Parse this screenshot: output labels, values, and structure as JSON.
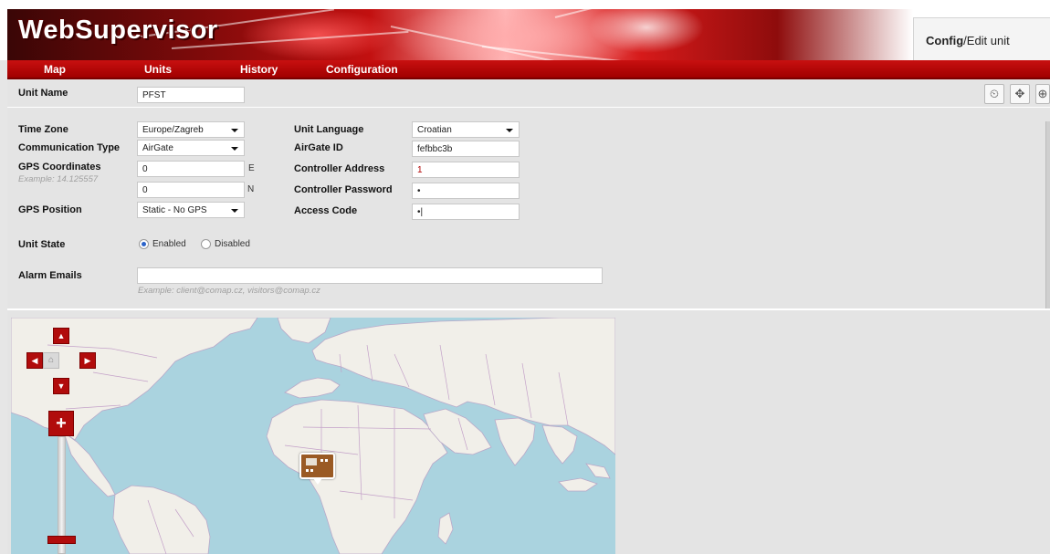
{
  "app": {
    "logo_text": "WebSupervisor",
    "page_tab_strong": "Config",
    "page_tab_rest": "/Edit unit"
  },
  "menu": {
    "items": [
      "Map",
      "Units",
      "History",
      "Configuration"
    ]
  },
  "toolbar": {
    "icons": [
      "settings-clock-icon",
      "move-icon",
      "zoom-icon"
    ]
  },
  "unit": {
    "name_label": "Unit Name",
    "name_value": "PFST"
  },
  "form": {
    "time_zone": {
      "label": "Time Zone",
      "value": "Europe/Zagreb"
    },
    "communication_type": {
      "label": "Communication Type",
      "value": "AirGate"
    },
    "gps_coordinates": {
      "label": "GPS Coordinates",
      "example": "Example: 14.125557",
      "lon_value": "0",
      "lon_suffix": "E",
      "lat_value": "0",
      "lat_suffix": "N"
    },
    "gps_position": {
      "label": "GPS Position",
      "value": "Static - No GPS"
    },
    "unit_language": {
      "label": "Unit Language",
      "value": "Croatian"
    },
    "airgate_id": {
      "label": "AirGate ID",
      "value": "fefbbc3b"
    },
    "controller_address": {
      "label": "Controller Address",
      "value": "1"
    },
    "controller_password": {
      "label": "Controller Password",
      "value": "•"
    },
    "access_code": {
      "label": "Access Code",
      "value": "•|"
    },
    "unit_state": {
      "label": "Unit State",
      "options": [
        "Enabled",
        "Disabled"
      ],
      "selected": "Enabled"
    },
    "alarm_emails": {
      "label": "Alarm Emails",
      "value": "",
      "example": "Example: client@comap.cz, visitors@comap.cz"
    }
  },
  "map": {
    "nav_icons": [
      "pan-up-icon",
      "pan-left-icon",
      "home-icon",
      "pan-right-icon",
      "pan-down-icon"
    ],
    "zoom_in_label": "+",
    "marker_icon": "controller-unit-icon"
  },
  "colors": {
    "brand_red": "#b10c0c",
    "ocean": "#aad3df",
    "land": "#f1efe9",
    "radio_selected": "#2a62c9"
  }
}
